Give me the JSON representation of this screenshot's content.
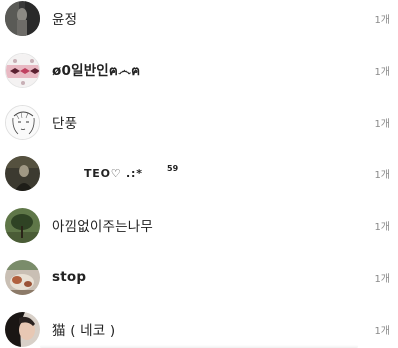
{
  "rows": [
    {
      "name": "윤정",
      "count": "1개",
      "avatar_icon": "dark-photo-avatar"
    },
    {
      "name": "ø0일반인ฅ෴ฅ",
      "count": "1개",
      "avatar_icon": "fish-pattern-avatar"
    },
    {
      "name": "단풍",
      "count": "1개",
      "avatar_icon": "sketch-face-avatar"
    },
    {
      "name": "TEO♡ .:*",
      "superscript": "59",
      "count": "1개",
      "avatar_icon": "dark-figure-avatar"
    },
    {
      "name": "아낌없이주는나무",
      "count": "1개",
      "avatar_icon": "tree-avatar"
    },
    {
      "name": "stop",
      "count": "1개",
      "avatar_icon": "cat-photo-avatar"
    },
    {
      "name": "猫 ( 네코 )",
      "count": "1개",
      "avatar_icon": "person-photo-avatar"
    }
  ]
}
